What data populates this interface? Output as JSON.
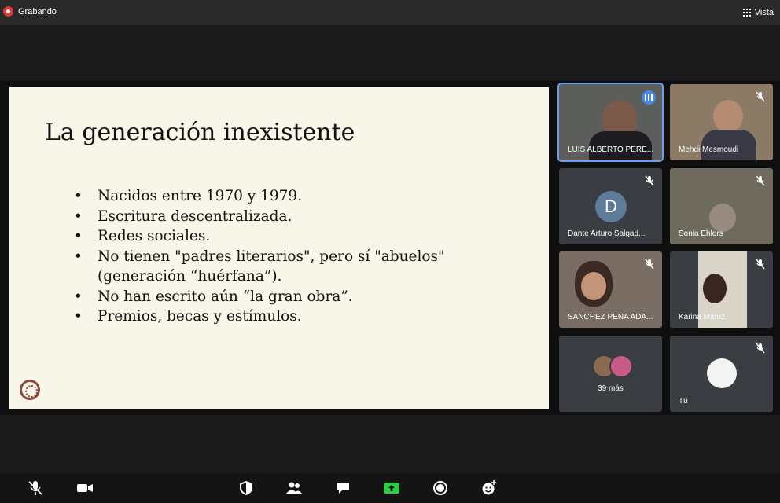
{
  "top": {
    "recording_label": "Grabando",
    "view_label": "Vista"
  },
  "slide": {
    "title": "La generación inexistente",
    "bullets": [
      "Nacidos entre 1970 y 1979.",
      "Escritura descentralizada.",
      "Redes sociales.",
      "No tienen \"padres literarios\", pero sí \"abuelos\" (generación “huérfana”).",
      "No han escrito aún “la gran obra”.",
      "Premios, becas y estímulos."
    ]
  },
  "participants": [
    {
      "name": "LUIS ALBERTO PERE...",
      "state": "speaking"
    },
    {
      "name": "Mehdi Mesmoudi",
      "state": "muted"
    },
    {
      "name": "Dante Arturo Salgad...",
      "state": "muted",
      "initial": "D"
    },
    {
      "name": "Sonia Ehlers",
      "state": "muted"
    },
    {
      "name": "SANCHEZ PEÑA ADA...",
      "state": "muted"
    },
    {
      "name": "Karina Matuz",
      "state": "muted"
    },
    {
      "more_label": "39 más"
    },
    {
      "name": "Tú",
      "state": "muted"
    }
  ],
  "colors": {
    "accent": "#4a86e8",
    "record": "#e03a36",
    "share": "#2ecc40"
  }
}
